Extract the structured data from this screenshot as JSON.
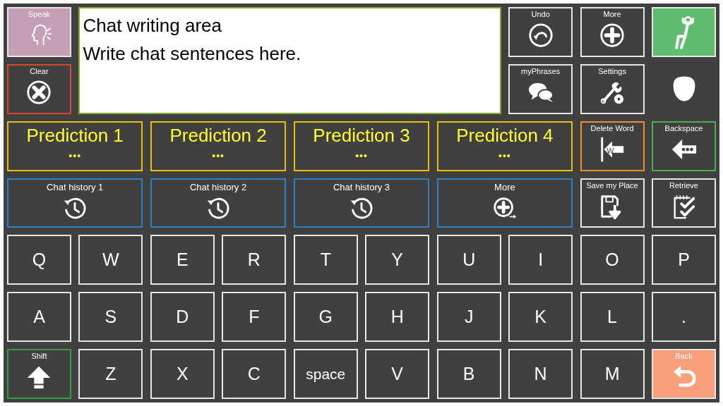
{
  "tiles": [
    {
      "kind": "speak",
      "label": "Speak",
      "color": "#c49fb5"
    },
    {
      "kind": "text_area",
      "lines": [
        "Chat writing area",
        "Write chat sentences here."
      ],
      "color": "#8aa52c"
    },
    {
      "kind": "undo",
      "label": "Undo"
    },
    {
      "kind": "more",
      "label": "More"
    },
    {
      "kind": "relax",
      "color": "#5ebd6e"
    },
    {
      "kind": "clear",
      "label": "Clear",
      "color": "#d9452f"
    },
    {
      "kind": "phrases",
      "label": "myPhrases"
    },
    {
      "kind": "settings",
      "label": "Settings"
    },
    {
      "kind": "mask"
    },
    {
      "kind": "prediction",
      "label": "Prediction 1",
      "sublabel": "•••",
      "color": "#e8c000"
    },
    {
      "kind": "prediction",
      "label": "Prediction 2",
      "sublabel": "•••",
      "color": "#e8c000"
    },
    {
      "kind": "prediction",
      "label": "Prediction 3",
      "sublabel": "•••",
      "color": "#e8c000"
    },
    {
      "kind": "prediction",
      "label": "Prediction 4",
      "sublabel": "•••",
      "color": "#e8c000"
    },
    {
      "kind": "delete_word",
      "label": "Delete Word",
      "icon_text": "W",
      "color": "#f0901e"
    },
    {
      "kind": "backspace",
      "label": "Backspace",
      "color": "#4caf50"
    },
    {
      "kind": "history",
      "label": "Chat history 1",
      "color": "#2f7fc1"
    },
    {
      "kind": "history",
      "label": "Chat history 2",
      "color": "#2f7fc1"
    },
    {
      "kind": "history",
      "label": "Chat history 3",
      "color": "#2f7fc1"
    },
    {
      "kind": "more_history",
      "label": "More",
      "color": "#2f7fc1"
    },
    {
      "kind": "save",
      "label": "Save my Place"
    },
    {
      "kind": "retrieve",
      "label": "Retrieve"
    },
    {
      "kind": "key",
      "label": "Q"
    },
    {
      "kind": "key",
      "label": "W"
    },
    {
      "kind": "key",
      "label": "E"
    },
    {
      "kind": "key",
      "label": "R"
    },
    {
      "kind": "key",
      "label": "T"
    },
    {
      "kind": "key",
      "label": "Y"
    },
    {
      "kind": "key",
      "label": "U"
    },
    {
      "kind": "key",
      "label": "I"
    },
    {
      "kind": "key",
      "label": "O"
    },
    {
      "kind": "key",
      "label": "P"
    },
    {
      "kind": "key",
      "label": "A"
    },
    {
      "kind": "key",
      "label": "S"
    },
    {
      "kind": "key",
      "label": "D"
    },
    {
      "kind": "key",
      "label": "F"
    },
    {
      "kind": "key",
      "label": "G"
    },
    {
      "kind": "key",
      "label": "H"
    },
    {
      "kind": "key",
      "label": "J"
    },
    {
      "kind": "key",
      "label": "K"
    },
    {
      "kind": "key",
      "label": "L"
    },
    {
      "kind": "key",
      "label": "."
    },
    {
      "kind": "shift",
      "label": "Shift",
      "color": "#3a9a40"
    },
    {
      "kind": "key",
      "label": "Z"
    },
    {
      "kind": "key",
      "label": "X"
    },
    {
      "kind": "key",
      "label": "C"
    },
    {
      "kind": "space",
      "label": "space"
    },
    {
      "kind": "key",
      "label": "V"
    },
    {
      "kind": "key",
      "label": "B"
    },
    {
      "kind": "key",
      "label": "N"
    },
    {
      "kind": "key",
      "label": "M"
    },
    {
      "kind": "back",
      "label": "Back",
      "color": "#f9a07a"
    }
  ]
}
